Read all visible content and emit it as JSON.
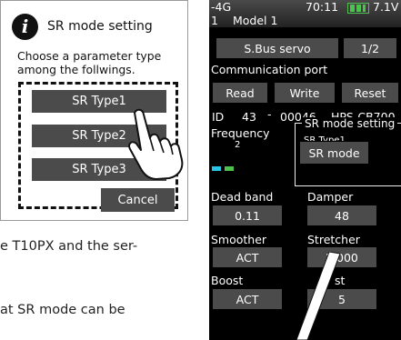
{
  "dialog": {
    "info_glyph": "i",
    "title": "SR mode setting",
    "prompt_line1": "Choose a parameter type",
    "prompt_line2": "among the follwings.",
    "options": [
      "SR Type1",
      "SR Type2",
      "SR Type3"
    ],
    "cancel_label": "Cancel"
  },
  "page_text": {
    "line1": "e T10PX and the ser-",
    "line2": "at SR mode can be"
  },
  "screen": {
    "signal": "-4G",
    "clock": "70:11",
    "battery": "7.1V",
    "model_num": "1",
    "model_name": "Model 1",
    "servo_label": "S.Bus servo",
    "page": "1/2",
    "comm_port": "Communication port",
    "read": "Read",
    "write": "Write",
    "reset": "Reset",
    "id_label": "ID",
    "id_value": "43",
    "dash": "-",
    "serial": "00046",
    "model_code": "HPS-CB700",
    "frequency_label": "Frequency",
    "frequency_value": "2",
    "sr_group_label": "SR mode setting",
    "sr_type_partial": "SR Type1",
    "sr_mode_button": "SR mode",
    "dead_band_label": "Dead band",
    "dead_band_value": "0.11",
    "damper_label": "Damper",
    "damper_value": "48",
    "smoother_label": "Smoother",
    "smoother_value": "ACT",
    "stretcher_label": "Stretcher",
    "stretcher_value": "2.000",
    "boost_label": "Boost",
    "boost_value": "ACT",
    "boost2_label": "st",
    "boost2_value": "5"
  },
  "colors": {
    "button_gray": "#4b4b4b",
    "screen_bg": "#000000",
    "battery_green": "#4ec24e",
    "indicator_cyan": "#29c5e6"
  }
}
